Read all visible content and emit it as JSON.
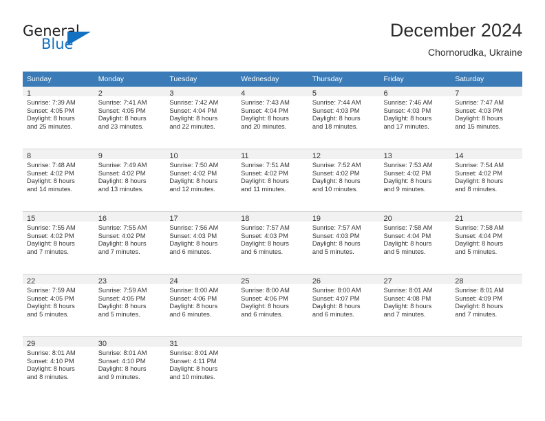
{
  "logo": {
    "primary_text": "General",
    "secondary_text": "Blue",
    "triangle_icon": "blue-triangle-icon",
    "primary_color": "#1d1d1d",
    "secondary_color": "#1271c1"
  },
  "header": {
    "title": "December 2024",
    "subtitle": "Chornorudka, Ukraine"
  },
  "theme": {
    "header_row_bg": "#3b7cb8",
    "header_row_text": "#ffffff",
    "daynum_bg": "#f1f1f1",
    "cell_bg": "#ffffff",
    "divider": "#d4d4d4",
    "text": "#333333"
  },
  "calendar": {
    "weekday_headers": [
      "Sunday",
      "Monday",
      "Tuesday",
      "Wednesday",
      "Thursday",
      "Friday",
      "Saturday"
    ],
    "weeks": [
      [
        {
          "day": "1",
          "sunrise": "Sunrise: 7:39 AM",
          "sunset": "Sunset: 4:05 PM",
          "daylight_line1": "Daylight: 8 hours",
          "daylight_line2": "and 25 minutes."
        },
        {
          "day": "2",
          "sunrise": "Sunrise: 7:41 AM",
          "sunset": "Sunset: 4:05 PM",
          "daylight_line1": "Daylight: 8 hours",
          "daylight_line2": "and 23 minutes."
        },
        {
          "day": "3",
          "sunrise": "Sunrise: 7:42 AM",
          "sunset": "Sunset: 4:04 PM",
          "daylight_line1": "Daylight: 8 hours",
          "daylight_line2": "and 22 minutes."
        },
        {
          "day": "4",
          "sunrise": "Sunrise: 7:43 AM",
          "sunset": "Sunset: 4:04 PM",
          "daylight_line1": "Daylight: 8 hours",
          "daylight_line2": "and 20 minutes."
        },
        {
          "day": "5",
          "sunrise": "Sunrise: 7:44 AM",
          "sunset": "Sunset: 4:03 PM",
          "daylight_line1": "Daylight: 8 hours",
          "daylight_line2": "and 18 minutes."
        },
        {
          "day": "6",
          "sunrise": "Sunrise: 7:46 AM",
          "sunset": "Sunset: 4:03 PM",
          "daylight_line1": "Daylight: 8 hours",
          "daylight_line2": "and 17 minutes."
        },
        {
          "day": "7",
          "sunrise": "Sunrise: 7:47 AM",
          "sunset": "Sunset: 4:03 PM",
          "daylight_line1": "Daylight: 8 hours",
          "daylight_line2": "and 15 minutes."
        }
      ],
      [
        {
          "day": "8",
          "sunrise": "Sunrise: 7:48 AM",
          "sunset": "Sunset: 4:02 PM",
          "daylight_line1": "Daylight: 8 hours",
          "daylight_line2": "and 14 minutes."
        },
        {
          "day": "9",
          "sunrise": "Sunrise: 7:49 AM",
          "sunset": "Sunset: 4:02 PM",
          "daylight_line1": "Daylight: 8 hours",
          "daylight_line2": "and 13 minutes."
        },
        {
          "day": "10",
          "sunrise": "Sunrise: 7:50 AM",
          "sunset": "Sunset: 4:02 PM",
          "daylight_line1": "Daylight: 8 hours",
          "daylight_line2": "and 12 minutes."
        },
        {
          "day": "11",
          "sunrise": "Sunrise: 7:51 AM",
          "sunset": "Sunset: 4:02 PM",
          "daylight_line1": "Daylight: 8 hours",
          "daylight_line2": "and 11 minutes."
        },
        {
          "day": "12",
          "sunrise": "Sunrise: 7:52 AM",
          "sunset": "Sunset: 4:02 PM",
          "daylight_line1": "Daylight: 8 hours",
          "daylight_line2": "and 10 minutes."
        },
        {
          "day": "13",
          "sunrise": "Sunrise: 7:53 AM",
          "sunset": "Sunset: 4:02 PM",
          "daylight_line1": "Daylight: 8 hours",
          "daylight_line2": "and 9 minutes."
        },
        {
          "day": "14",
          "sunrise": "Sunrise: 7:54 AM",
          "sunset": "Sunset: 4:02 PM",
          "daylight_line1": "Daylight: 8 hours",
          "daylight_line2": "and 8 minutes."
        }
      ],
      [
        {
          "day": "15",
          "sunrise": "Sunrise: 7:55 AM",
          "sunset": "Sunset: 4:02 PM",
          "daylight_line1": "Daylight: 8 hours",
          "daylight_line2": "and 7 minutes."
        },
        {
          "day": "16",
          "sunrise": "Sunrise: 7:55 AM",
          "sunset": "Sunset: 4:02 PM",
          "daylight_line1": "Daylight: 8 hours",
          "daylight_line2": "and 7 minutes."
        },
        {
          "day": "17",
          "sunrise": "Sunrise: 7:56 AM",
          "sunset": "Sunset: 4:03 PM",
          "daylight_line1": "Daylight: 8 hours",
          "daylight_line2": "and 6 minutes."
        },
        {
          "day": "18",
          "sunrise": "Sunrise: 7:57 AM",
          "sunset": "Sunset: 4:03 PM",
          "daylight_line1": "Daylight: 8 hours",
          "daylight_line2": "and 6 minutes."
        },
        {
          "day": "19",
          "sunrise": "Sunrise: 7:57 AM",
          "sunset": "Sunset: 4:03 PM",
          "daylight_line1": "Daylight: 8 hours",
          "daylight_line2": "and 5 minutes."
        },
        {
          "day": "20",
          "sunrise": "Sunrise: 7:58 AM",
          "sunset": "Sunset: 4:04 PM",
          "daylight_line1": "Daylight: 8 hours",
          "daylight_line2": "and 5 minutes."
        },
        {
          "day": "21",
          "sunrise": "Sunrise: 7:58 AM",
          "sunset": "Sunset: 4:04 PM",
          "daylight_line1": "Daylight: 8 hours",
          "daylight_line2": "and 5 minutes."
        }
      ],
      [
        {
          "day": "22",
          "sunrise": "Sunrise: 7:59 AM",
          "sunset": "Sunset: 4:05 PM",
          "daylight_line1": "Daylight: 8 hours",
          "daylight_line2": "and 5 minutes."
        },
        {
          "day": "23",
          "sunrise": "Sunrise: 7:59 AM",
          "sunset": "Sunset: 4:05 PM",
          "daylight_line1": "Daylight: 8 hours",
          "daylight_line2": "and 5 minutes."
        },
        {
          "day": "24",
          "sunrise": "Sunrise: 8:00 AM",
          "sunset": "Sunset: 4:06 PM",
          "daylight_line1": "Daylight: 8 hours",
          "daylight_line2": "and 6 minutes."
        },
        {
          "day": "25",
          "sunrise": "Sunrise: 8:00 AM",
          "sunset": "Sunset: 4:06 PM",
          "daylight_line1": "Daylight: 8 hours",
          "daylight_line2": "and 6 minutes."
        },
        {
          "day": "26",
          "sunrise": "Sunrise: 8:00 AM",
          "sunset": "Sunset: 4:07 PM",
          "daylight_line1": "Daylight: 8 hours",
          "daylight_line2": "and 6 minutes."
        },
        {
          "day": "27",
          "sunrise": "Sunrise: 8:01 AM",
          "sunset": "Sunset: 4:08 PM",
          "daylight_line1": "Daylight: 8 hours",
          "daylight_line2": "and 7 minutes."
        },
        {
          "day": "28",
          "sunrise": "Sunrise: 8:01 AM",
          "sunset": "Sunset: 4:09 PM",
          "daylight_line1": "Daylight: 8 hours",
          "daylight_line2": "and 7 minutes."
        }
      ],
      [
        {
          "day": "29",
          "sunrise": "Sunrise: 8:01 AM",
          "sunset": "Sunset: 4:10 PM",
          "daylight_line1": "Daylight: 8 hours",
          "daylight_line2": "and 8 minutes."
        },
        {
          "day": "30",
          "sunrise": "Sunrise: 8:01 AM",
          "sunset": "Sunset: 4:10 PM",
          "daylight_line1": "Daylight: 8 hours",
          "daylight_line2": "and 9 minutes."
        },
        {
          "day": "31",
          "sunrise": "Sunrise: 8:01 AM",
          "sunset": "Sunset: 4:11 PM",
          "daylight_line1": "Daylight: 8 hours",
          "daylight_line2": "and 10 minutes."
        },
        {
          "day": "",
          "sunrise": "",
          "sunset": "",
          "daylight_line1": "",
          "daylight_line2": ""
        },
        {
          "day": "",
          "sunrise": "",
          "sunset": "",
          "daylight_line1": "",
          "daylight_line2": ""
        },
        {
          "day": "",
          "sunrise": "",
          "sunset": "",
          "daylight_line1": "",
          "daylight_line2": ""
        },
        {
          "day": "",
          "sunrise": "",
          "sunset": "",
          "daylight_line1": "",
          "daylight_line2": ""
        }
      ]
    ]
  }
}
